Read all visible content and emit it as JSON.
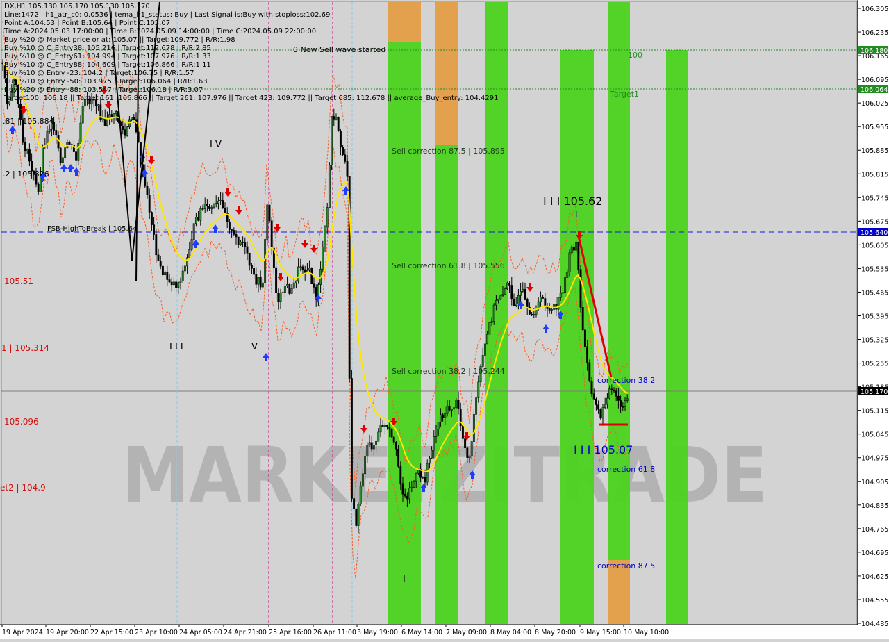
{
  "header": {
    "symbol_label": "DX,H1",
    "info_lines": [
      "DX,H1  105.130 105.170 105.130 105.170",
      "Line:1472 | h1_atr_c0: 0.0536 | tema_h1_status: Buy | Last Signal is:Buy with stoploss:102.69",
      "Point A:104.53 | Point B:105.64 | Point C:105.07",
      "Time A:2024.05.03 17:00:00 | Time B:2024.05.09 14:00:00 | Time C:2024.05.09 22:00:00",
      "Buy %20 @ Market price or at: 105.07 || Target:109.772 | R/R:1.98",
      "Buy %10 @ C_Entry38: 105.216 | Target:112.678 | R/R:2.85",
      "Buy %10 @ C_Entry61: 104.994 | Target:107.976 | R/R:1.33",
      "Buy %10 @ C_Entry88: 104.609 | Target:106.866 | R/R:1.11",
      "Buy %10 @ Entry -23: 104.2 | Target:106.75 | R/R:1.57",
      "Buy %10 @ Entry -50: 103.975 | Target:106.064 | R/R:1.63",
      "Buy %20 @ Entry -88: 103.547 | Target:106.18 | R/R:3.07",
      "Target100: 106.18 || Target 161: 106.866 || Target 261: 107.976 || Target 423: 109.772 || Target 685: 112.678 || average_Buy_entry: 104.4291"
    ]
  },
  "chart_data": {
    "type": "candlestick",
    "symbol": "DX",
    "timeframe": "H1",
    "last_price": 105.17,
    "y_axis": {
      "range": [
        104.485,
        106.305
      ],
      "ticks": [
        "106.305",
        "106.235",
        "106.165",
        "106.095",
        "106.025",
        "105.955",
        "105.885",
        "105.815",
        "105.745",
        "105.675",
        "105.605",
        "105.535",
        "105.465",
        "105.395",
        "105.325",
        "105.255",
        "105.185",
        "105.115",
        "105.045",
        "104.975",
        "104.905",
        "104.835",
        "104.765",
        "104.695",
        "104.625",
        "104.555",
        "104.485"
      ]
    },
    "x_axis": {
      "labels": [
        "19 Apr 2024",
        "19 Apr 20:00",
        "22 Apr 15:00",
        "23 Apr 10:00",
        "24 Apr 05:00",
        "24 Apr 21:00",
        "25 Apr 16:00",
        "26 Apr 11:00",
        "3 May 19:00",
        "6 May 14:00",
        "7 May 09:00",
        "8 May 04:00",
        "8 May 20:00",
        "9 May 15:00",
        "10 May 10:00"
      ]
    },
    "price_tags": [
      {
        "label": "106.180",
        "color": "#228b22"
      },
      {
        "label": "106.064",
        "color": "#228b22"
      },
      {
        "label": "105.640",
        "color": "#0000cd"
      },
      {
        "label": "105.170",
        "color": "#000000"
      }
    ],
    "horizontal_lines": [
      {
        "price": 106.18,
        "color": "#228b22",
        "style": "dotted"
      },
      {
        "price": 106.064,
        "color": "#228b22",
        "style": "dotted"
      },
      {
        "price": 105.64,
        "color": "#0000cd",
        "style": "dashed"
      },
      {
        "price": 105.17,
        "color": "#808080",
        "style": "solid"
      }
    ],
    "vertical_lines": [
      {
        "label": "25 Apr 16:00",
        "color": "#c71585"
      },
      {
        "label": "26 Apr 11:00",
        "color": "#c71585"
      },
      {
        "label": "19 Apr 20:00",
        "color": "#87ceeb"
      },
      {
        "label": "24 Apr 21:00",
        "color": "#87ceeb"
      }
    ],
    "annotations": {
      "new_sell_wave": "0 New Sell wave started",
      "target100": "100",
      "target1": "Target1",
      "sell_corr_875": "Sell correction 87.5 | 105.895",
      "sell_corr_618": "Sell correction 61.8 | 105.556",
      "sell_corr_382": "Sell correction 38.2 | 105.244",
      "wave_IV": "I V",
      "wave_III_top": "I I I 105.62",
      "wave_III_left": "I I I",
      "wave_V": "V",
      "wave_III_bottom": "I I I 105.07",
      "wave_I_bottom": "I",
      "wave_I_top": "I",
      "fsb": "FSB-HighToBreak | 105.64",
      "corr_382": "correction 38.2",
      "corr_618": "correction 61.8",
      "corr_875": "correction 87.5",
      "left_1": "105.51",
      "left_2": "1 | 105.314",
      "left_3": "105.096",
      "left_4": "et2 | 104.9",
      "left_5": ".81 | 105.884",
      "left_6": ".2 | 105.826"
    },
    "watermark": "MARKETZITRADE"
  }
}
